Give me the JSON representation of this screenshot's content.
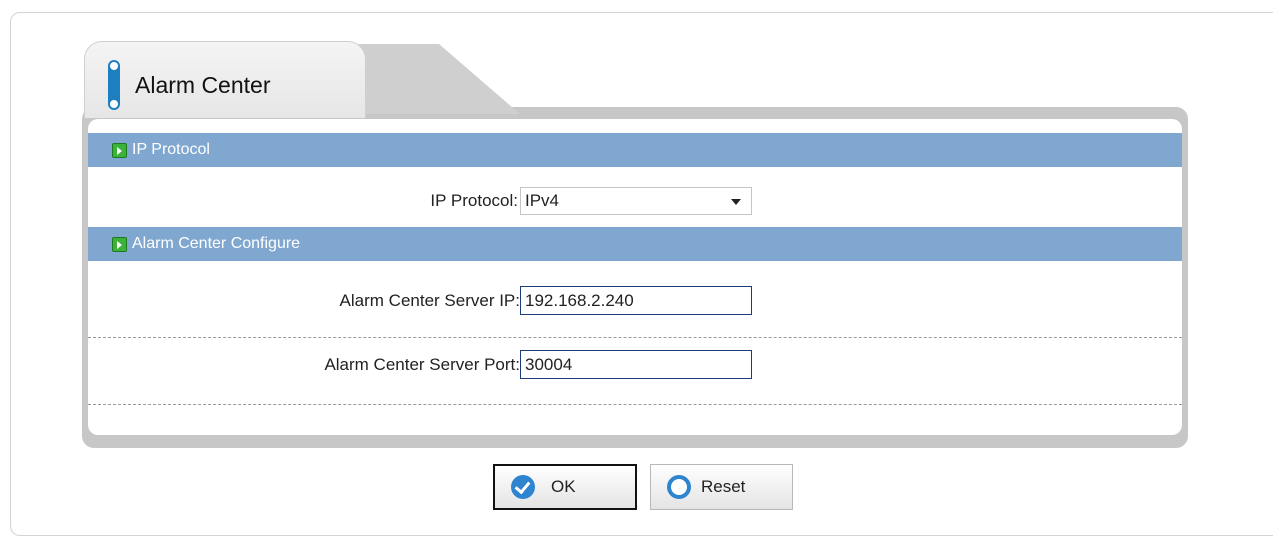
{
  "tabs": [
    {
      "label": "Alarm Center",
      "active": true
    }
  ],
  "sections": {
    "ip_protocol": {
      "header": "IP Protocol",
      "label": "IP Protocol:",
      "selected": "IPv4"
    },
    "alarm_center": {
      "header": "Alarm Center Configure",
      "server_ip_label": "Alarm Center Server IP:",
      "server_ip_value": "192.168.2.240",
      "server_port_label": "Alarm Center Server Port:",
      "server_port_value": "30004"
    }
  },
  "buttons": {
    "ok_label": "OK",
    "reset_label": "Reset"
  },
  "colors": {
    "section_header": "#7fa7d0",
    "accent_blue": "#2f84d0",
    "section_icon_green": "#3bb33b"
  }
}
